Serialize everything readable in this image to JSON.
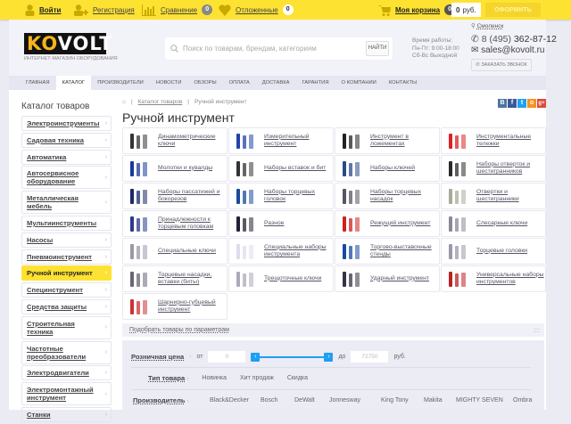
{
  "topbar": {
    "login": "Войти",
    "register": "Регистрация",
    "compare": "Сравнение",
    "compare_count": "0",
    "favorites": "Отложенные",
    "favorites_count": "0",
    "cart": "Моя корзина",
    "cart_count": "0",
    "cart_sum": "0",
    "currency": "руб.",
    "checkout": "ОФОРМИТЬ"
  },
  "header": {
    "logo_ko": "KO",
    "logo_volt": "VOLT",
    "logo_sub": "ИНТЕРНЕТ-МАГАЗИН ОБОРУДОВАНИЯ",
    "search_placeholder": "Поиск по товарам, брендам, категориям",
    "search_btn": "НАЙТИ",
    "hours": [
      "Время работы:",
      "Пн-Пт: 9:00-18:00",
      "Сб-Вс Выходной"
    ],
    "city": "Смоленск",
    "phone_prefix": "8 (495)",
    "phone_num": "362-87-12",
    "email": "sales@kovolt.ru",
    "callback": "ЗАКАЗАТЬ ЗВОНОК"
  },
  "nav": [
    "Главная",
    "Каталог",
    "Производители",
    "Новости",
    "Обзоры",
    "Оплата",
    "Доставка",
    "Гарантия",
    "О компании",
    "Контакты"
  ],
  "sidebar": {
    "title": "Каталог товаров",
    "items": [
      "Электроинструменты",
      "Садовая техника",
      "Автоматика",
      "Автосервисное оборудование",
      "Металлическая мебель",
      "Мультиинструменты",
      "Насосы",
      "Пневмоинструмент",
      "Ручной инструмент",
      "Специнструмент",
      "Средства защиты",
      "Строительная техника",
      "Частотные преобразователи",
      "Электродвигатели",
      "Электромонтажный инструмент",
      "Станки"
    ]
  },
  "breadcrumb": {
    "catalog": "Каталог товаров",
    "current": "Ручной инструмент"
  },
  "page_title": "Ручной инструмент",
  "social": [
    "В",
    "f",
    "t",
    "о",
    "g+"
  ],
  "categories": [
    {
      "label": "Динамометрические ключи",
      "color": "#333"
    },
    {
      "label": "Измерительный инструмент",
      "color": "#2244aa"
    },
    {
      "label": "Инструмент в ложементах",
      "color": "#222"
    },
    {
      "label": "Инструментальные тележки",
      "color": "#d22"
    },
    {
      "label": "Молотки и кувалды",
      "color": "#1a3a9a"
    },
    {
      "label": "Наборы вставок и бит",
      "color": "#333"
    },
    {
      "label": "Наборы ключей",
      "color": "#2a4a8a"
    },
    {
      "label": "Наборы отверток и шестигранников",
      "color": "#2a2a2a"
    },
    {
      "label": "Наборы пассатижей и бокорезов",
      "color": "#1a2a6a"
    },
    {
      "label": "Наборы торцевых головок",
      "color": "#1a4a9a"
    },
    {
      "label": "Наборы торцевых насадок",
      "color": "#556"
    },
    {
      "label": "Отвертки и шестигранники",
      "color": "#aa9"
    },
    {
      "label": "Принадлежности к торцевым головкам",
      "color": "#2a3a8a"
    },
    {
      "label": "Разное",
      "color": "#223"
    },
    {
      "label": "Режущий инструмент",
      "color": "#c22"
    },
    {
      "label": "Слесарные ключи",
      "color": "#889"
    },
    {
      "label": "Специальные ключи",
      "color": "#99a"
    },
    {
      "label": "Специальные наборы инструмента",
      "color": "#dde"
    },
    {
      "label": "Торгово-выставочные стенды",
      "color": "#1a4aa0"
    },
    {
      "label": "Торцевые головки",
      "color": "#99a"
    },
    {
      "label": "Торцевые насадки, вставки (биты)",
      "color": "#667"
    },
    {
      "label": "Трещоточные ключи",
      "color": "#aab"
    },
    {
      "label": "Ударный инструмент",
      "color": "#334"
    },
    {
      "label": "Универсальные наборы инструментов",
      "color": "#b22"
    },
    {
      "label": "Шарнирно-губцевый инструмент",
      "color": "#c33"
    }
  ],
  "filter": {
    "toggle": "Подобрать товары по параметрам",
    "price_label": "Розничная цена",
    "from": "от",
    "from_val": "0",
    "to": "до",
    "to_val": "72750",
    "currency": "руб.",
    "type_label": "Тип товара",
    "types": [
      "Новинка",
      "Хит продаж",
      "Скидка"
    ],
    "maker_label": "Производитель",
    "makers": [
      "Black&Decker",
      "Bosch",
      "DeWalt",
      "Jonnesway",
      "King Tony",
      "Makita",
      "MIGHTY SEVEN",
      "Ombra"
    ]
  }
}
